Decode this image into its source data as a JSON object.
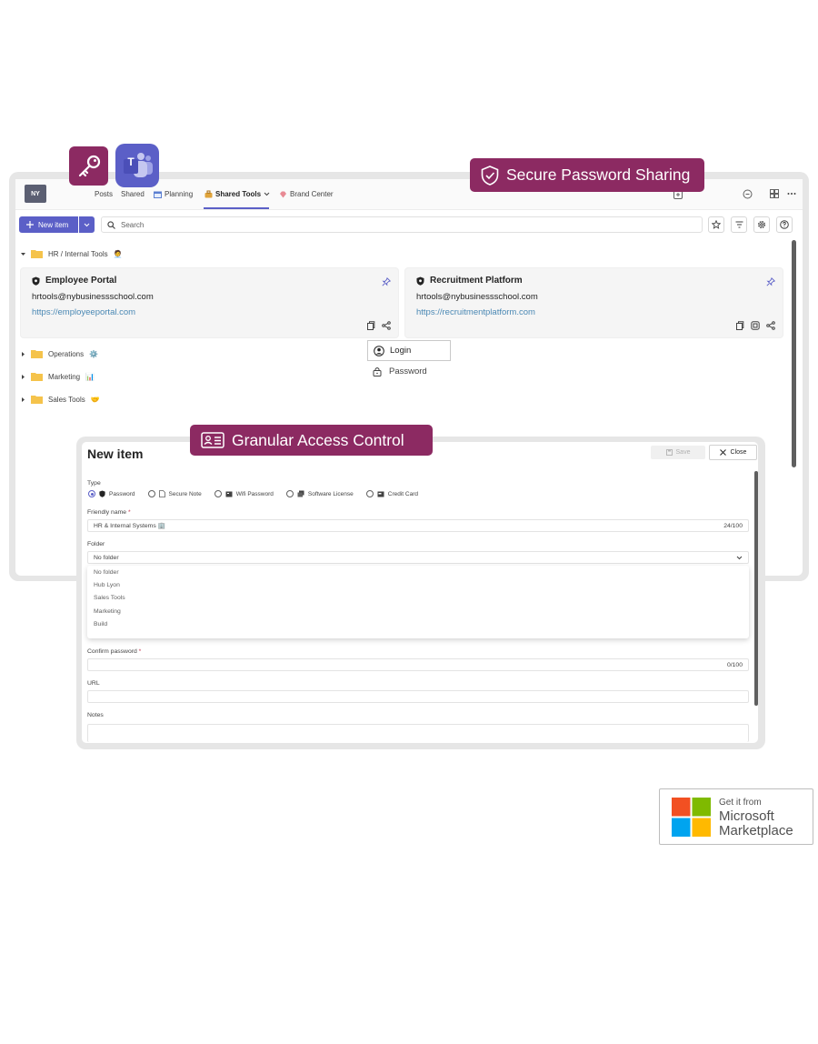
{
  "app_icons": {
    "keeper": "key-icon",
    "teams": "teams-icon",
    "teams_letter": "T"
  },
  "teams": {
    "avatar": "NY",
    "tabs": [
      {
        "label": "Posts"
      },
      {
        "label": "Shared"
      },
      {
        "label": "Planning"
      },
      {
        "label": "Shared Tools"
      },
      {
        "label": "Brand Center"
      }
    ],
    "active_tab": "Shared Tools"
  },
  "toolbar": {
    "new_item_label": "New item",
    "search_placeholder": "Search"
  },
  "folders": {
    "open": {
      "label": "HR / Internal Tools",
      "emoji": "🧑‍💼"
    },
    "closed": [
      {
        "label": "Operations",
        "emoji": "⚙️"
      },
      {
        "label": "Marketing",
        "emoji": "📊"
      },
      {
        "label": "Sales Tools",
        "emoji": "🤝"
      }
    ]
  },
  "cards": [
    {
      "title": "Employee Portal",
      "user": "hrtools@nybusinessschool.com",
      "url": "https://employeeportal.com"
    },
    {
      "title": "Recruitment Platform",
      "user": "hrtools@nybusinessschool.com",
      "url": "https://recruitmentplatform.com"
    }
  ],
  "context_menu": {
    "login": "Login",
    "password": "Password"
  },
  "banners": {
    "secure": "Secure Password Sharing",
    "granular": "Granular Access Control"
  },
  "dialog": {
    "title": "New item",
    "save": "Save",
    "close": "Close",
    "type_label": "Type",
    "types": [
      "Password",
      "Secure Note",
      "Wifi Password",
      "Software License",
      "Credit Card"
    ],
    "selected_type": "Password",
    "friendly_label": "Friendly name",
    "friendly_value": "HR & Internal Systems 🏢",
    "friendly_count": "24/100",
    "folder_label": "Folder",
    "folder_value": "No folder",
    "folder_options": [
      "No folder",
      "Hub Lyon",
      "Sales Tools",
      "Marketing",
      "Build"
    ],
    "confirm_label": "Confirm password",
    "confirm_count": "0/100",
    "url_label": "URL",
    "notes_label": "Notes",
    "required_mark": "*"
  },
  "marketplace": {
    "line1": "Get it from",
    "line2": "Microsoft",
    "line3": "Marketplace"
  },
  "colors": {
    "accent": "#5b5fc7",
    "banner": "#8c2a62",
    "link": "#4a88b4",
    "folder": "#f5c34b"
  }
}
